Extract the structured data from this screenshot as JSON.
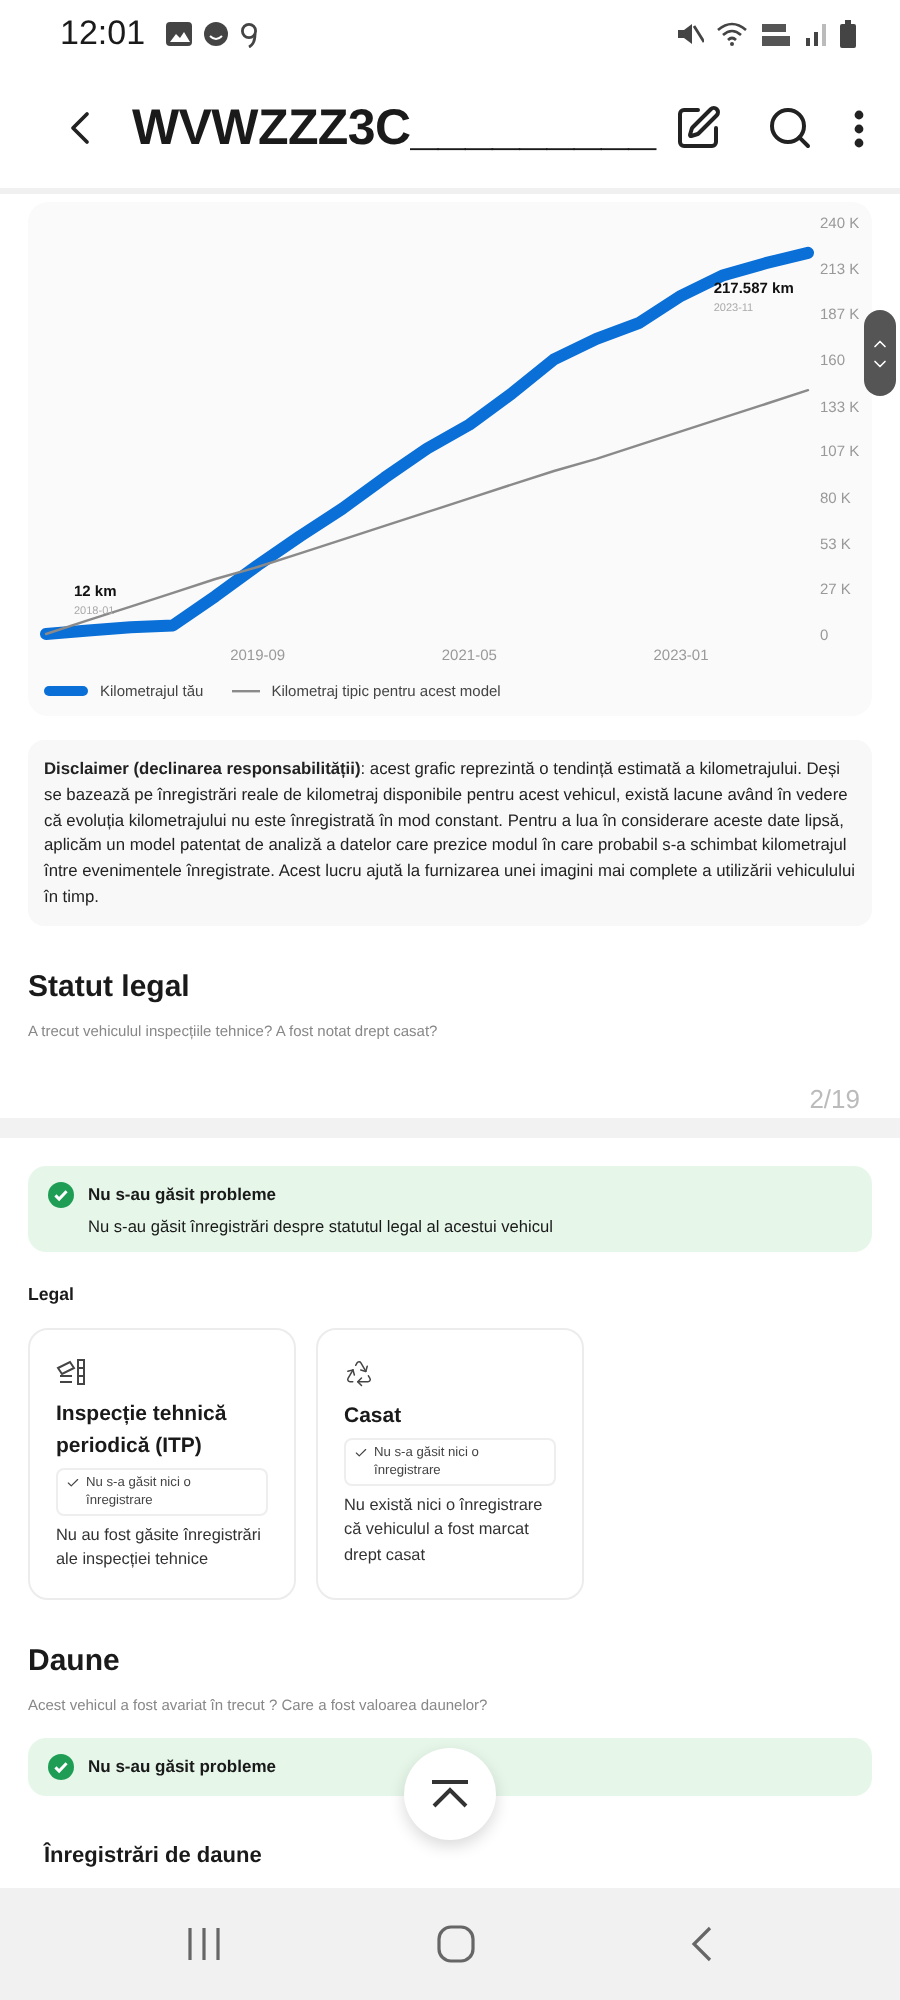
{
  "status_bar": {
    "time": "12:01"
  },
  "app_bar": {
    "title": "WVWZZZ3C_________"
  },
  "mileage_chart": {
    "chart_data": {
      "type": "line",
      "ylim": [
        0,
        240
      ],
      "categories": [
        null,
        null,
        null,
        null,
        null,
        "2019-09",
        null,
        null,
        null,
        null,
        "2021-05",
        null,
        null,
        null,
        null,
        "2023-01",
        null,
        null,
        null
      ],
      "series": [
        {
          "name": "Kilometrajul tău",
          "color": "#0a6fd6",
          "values": [
            0,
            2,
            4,
            5,
            22,
            40,
            57,
            73,
            91,
            108,
            122,
            140,
            160,
            172,
            181,
            197,
            209,
            216,
            222
          ]
        },
        {
          "name": "Kilometraj tipic pentru acest model",
          "color": "#8a8a8a",
          "values": [
            0,
            8,
            16,
            24,
            32,
            39,
            47,
            55,
            63,
            71,
            79,
            87,
            95,
            102,
            110,
            118,
            126,
            134,
            142
          ]
        }
      ],
      "yticks": [
        {
          "value": 0,
          "label": "0"
        },
        {
          "value": 27,
          "label": "27 K"
        },
        {
          "value": 53,
          "label": "53 K"
        },
        {
          "value": 80,
          "label": "80 K"
        },
        {
          "value": 107,
          "label": "107 K"
        },
        {
          "value": 133,
          "label": "133 K"
        },
        {
          "value": 160,
          "label": "160"
        },
        {
          "value": 187,
          "label": "187 K"
        },
        {
          "value": 213,
          "label": "213 K"
        },
        {
          "value": 240,
          "label": "240 K"
        }
      ],
      "annotations": [
        "12 km",
        "2018-01",
        "217.587 km",
        "2023-11"
      ]
    }
  },
  "disclaimer": "**Disclaimer (declinarea responsabilității)**: acest grafic reprezintă o tendință estimată a kilometrajului. Deși se bazează pe înregistrări reale de kilometraj disponibile pentru acest vehicul, există lacune având în vedere că evoluția kilometrajului nu este înregistrată în mod constant. Pentru a lua în considerare aceste date lipsă, aplicăm un model patentat de analiză a datelor care prezice modul în care probabil s-a schimbat kilometrajul între evenimentele înregistrate. Acest lucru ajută la furnizarea unei imagini mai complete a utilizării vehiculului în timp.",
  "legal_section": {
    "title": "Statut legal",
    "subtitle": "A trecut vehiculul inspecțiile tehnice? A fost notat drept casat?",
    "page_counter": "2/19",
    "alert": {
      "title": "Nu s-au găsit probleme",
      "text": "Nu s-au găsit înregistrări despre statutul legal al acestui vehicul"
    },
    "group_label": "Legal",
    "cards": [
      {
        "kind": "inspection",
        "title": "Inspecție tehnică periodică (ITP)",
        "badge": "Nu s-a găsit nici o înregistrare",
        "text": "Nu au fost găsite înregistrări ale inspecției tehnice"
      },
      {
        "kind": "scrapped",
        "title": "Casat",
        "badge": "Nu s-a găsit nici o înregistrare",
        "text": "Nu există nici o înregistrare că vehiculul a fost marcat drept casat"
      }
    ]
  },
  "damage_section": {
    "title": "Daune",
    "subtitle": "Acest vehicul a fost avariat în trecut ? Care a fost valoarea daunelor?",
    "alert": {
      "title": "Nu s-au găsit probleme"
    },
    "records_title": "Înregistrări de daune"
  }
}
